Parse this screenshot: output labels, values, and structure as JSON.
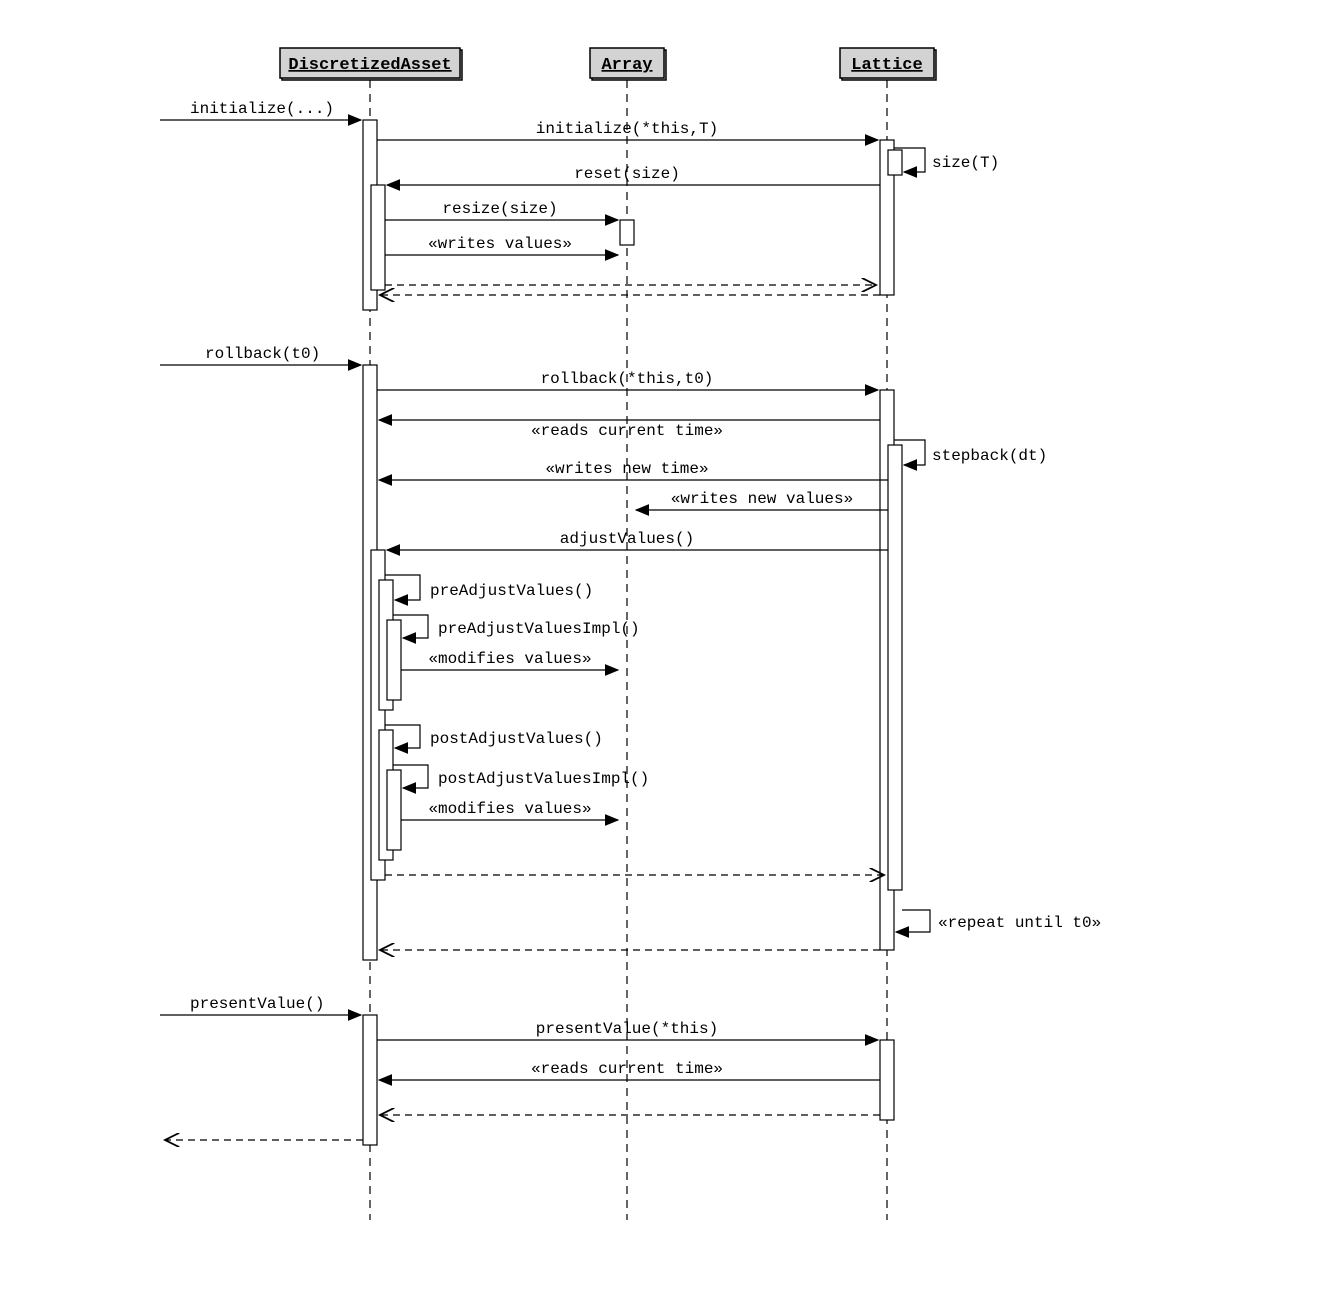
{
  "participants": {
    "p1": "DiscretizedAsset",
    "p2": "Array",
    "p3": "Lattice"
  },
  "messages": {
    "m1": "initialize(...)",
    "m2": "initialize(*this,T)",
    "m3": "size(T)",
    "m4": "reset(size)",
    "m5": "resize(size)",
    "m6": "«writes values»",
    "m7": "rollback(t0)",
    "m8": "rollback(*this,t0)",
    "m9": "«reads current time»",
    "m10": "stepback(dt)",
    "m11": "«writes new time»",
    "m12": "«writes new values»",
    "m13": "adjustValues()",
    "m14": "preAdjustValues()",
    "m15": "preAdjustValuesImpl()",
    "m16": "«modifies values»",
    "m17": "postAdjustValues()",
    "m18": "postAdjustValuesImpl()",
    "m19": "«modifies values»",
    "m20": "«repeat until t0»",
    "m21": "presentValue()",
    "m22": "presentValue(*this)",
    "m23": "«reads current time»"
  }
}
